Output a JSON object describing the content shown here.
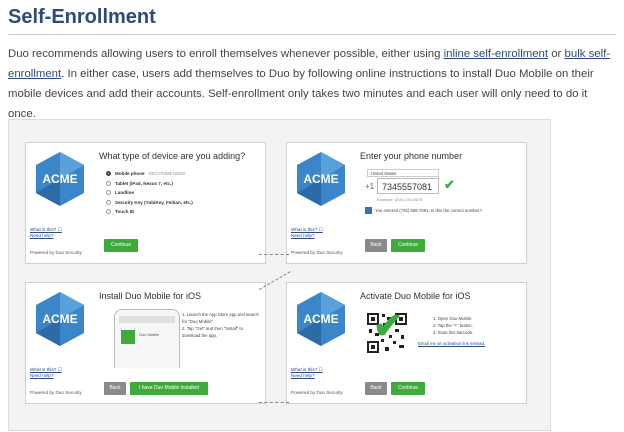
{
  "page": {
    "title": "Self-Enrollment",
    "intro_1": "Duo recommends allowing users to enroll themselves whenever possible, either using ",
    "link_inline": "inline self-enrollment",
    "intro_or": " or ",
    "link_bulk": "bulk self-enrollment",
    "intro_2": ". In either case, users add themselves to Duo by following online instructions to install Duo Mobile on their mobile devices and add their accounts. Self-enrollment only takes two minutes and each user will only need to do it once."
  },
  "brand": {
    "logo_text": "ACME",
    "hex_color": "#3a86c8",
    "hex_dark": "#2d6ba6"
  },
  "sidebar": {
    "what_is_this": "What is this? ☐",
    "need_help": "Need help?",
    "powered_by": "Powered by Duo Security"
  },
  "panel1": {
    "title": "What type of device are you adding?",
    "options": [
      "Mobile phone",
      "Tablet (iPad, Nexus 7, etc.)",
      "Landline",
      "Security Key (YubiKey, Feitian, etc.)",
      "Touch ID"
    ],
    "recommended": "RECOMMENDED",
    "continue_label": "Continue"
  },
  "panel2": {
    "title": "Enter your phone number",
    "country": "United States",
    "plus": "+1",
    "phone_value": "7345557081",
    "example": "Example: (201) 234-5678",
    "confirm_text": "You entered (734) 555-7081. Is this the correct number?",
    "back_label": "Back",
    "continue_label": "Continue"
  },
  "panel3": {
    "title": "Install Duo Mobile for iOS",
    "steps": [
      "1.  Launch the App Store app and search for \"Duo Mobile\".",
      "2.  Tap \"Get\" and then \"Install\" to download the app."
    ],
    "app_label": "Duo Mobile",
    "back_label": "Back",
    "installed_label": "I have Duo Mobile installed"
  },
  "panel4": {
    "title": "Activate Duo Mobile for iOS",
    "steps": [
      "1.  Open Duo Mobile.",
      "2.  Tap the \"+\" button.",
      "3.  Scan this barcode."
    ],
    "email_link": "Email me an activation link instead.",
    "back_label": "Back",
    "continue_label": "Continue"
  },
  "colors": {
    "accent_green": "#3cab3c",
    "link_blue": "#2c4a7a"
  }
}
